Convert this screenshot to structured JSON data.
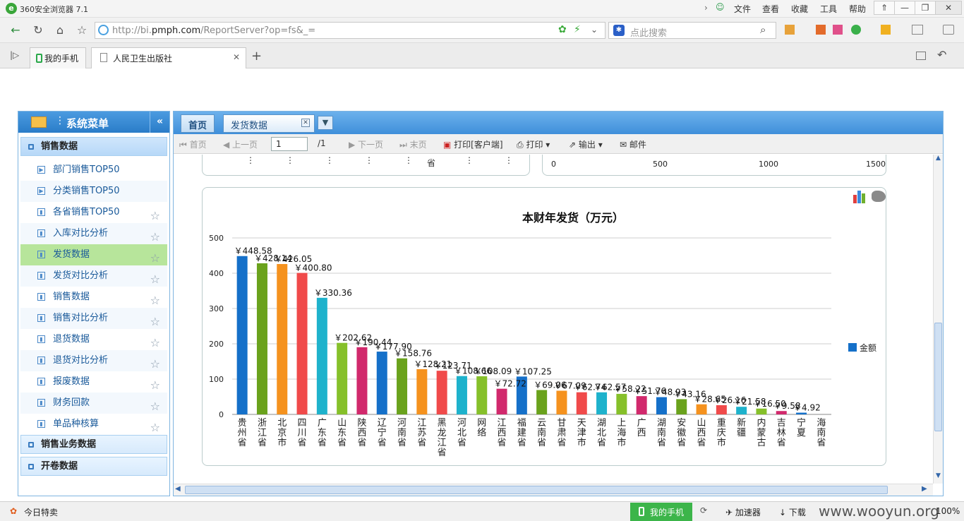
{
  "browser": {
    "title": "360安全浏览器 7.1",
    "logo": "e",
    "menu": [
      "文件",
      "查看",
      "收藏",
      "工具",
      "帮助"
    ],
    "url_prefix": "http://bi.",
    "url_domain": "pmph.com",
    "url_path": "/ReportServer?op=fs&_=",
    "search_placeholder": "点此搜索"
  },
  "tabs": [
    {
      "label": "我的手机"
    },
    {
      "label": "人民卫生出版社"
    }
  ],
  "sidebar": {
    "title": "系统菜单",
    "collapse_glyph": "«",
    "groups": [
      {
        "label": "销售数据"
      },
      {
        "label": "销售业务数据"
      },
      {
        "label": "开卷数据"
      }
    ],
    "items": [
      {
        "label": "部门销售TOP50"
      },
      {
        "label": "分类销售TOP50"
      },
      {
        "label": "各省销售TOP50"
      },
      {
        "label": "入库对比分析"
      },
      {
        "label": "发货数据"
      },
      {
        "label": "发货对比分析"
      },
      {
        "label": "销售数据"
      },
      {
        "label": "销售对比分析"
      },
      {
        "label": "退货数据"
      },
      {
        "label": "退货对比分析"
      },
      {
        "label": "报废数据"
      },
      {
        "label": "财务回款"
      },
      {
        "label": "单品种核算"
      }
    ]
  },
  "main": {
    "tabs": [
      {
        "label": "首页"
      },
      {
        "label": "发货数据"
      }
    ],
    "toolbar": {
      "first": "首页",
      "prev": "上一页",
      "page": "1",
      "total": "/1",
      "next": "下一页",
      "last": "末页",
      "print_client": "打印[客户端]",
      "print": "打印",
      "export": "输出",
      "mail": "邮件"
    },
    "top_chart_ticks": [
      "0",
      "500",
      "1000",
      "1500"
    ],
    "top_chart_partial_label": "省"
  },
  "chart_data": {
    "type": "bar",
    "title": "本财年发货（万元）",
    "legend": "金额",
    "legend_position": "right",
    "ylim": [
      0,
      500
    ],
    "yticks": [
      "0",
      "100",
      "200",
      "300",
      "400",
      "500"
    ],
    "grid": true,
    "value_prefix": "￥",
    "categories": [
      "贵州省",
      "浙江省",
      "北京市",
      "四川省",
      "广东省",
      "山东省",
      "陕西省",
      "辽宁省",
      "河南省",
      "江苏省",
      "黑龙江省",
      "河北省",
      "网络",
      "江西省",
      "福建省",
      "云南省",
      "甘肃省",
      "天津市",
      "湖北省",
      "上海市",
      "广西",
      "湖南省",
      "安徽省",
      "山西省",
      "重庆市",
      "新疆",
      "内蒙古",
      "吉林省",
      "宁夏",
      "海南省"
    ],
    "values": [
      448.58,
      428.14,
      426.05,
      400.8,
      330.36,
      202.62,
      190.44,
      177.9,
      158.76,
      128.21,
      123.71,
      108.66,
      108.09,
      72.72,
      107.25,
      69.06,
      67.09,
      62.74,
      62.57,
      58.22,
      51.76,
      48.93,
      43.16,
      28.65,
      26.16,
      21.58,
      16.5,
      9.58,
      4.92
    ],
    "colors": [
      "#1570c9",
      "#6aa21c",
      "#f5921e",
      "#f04a4a",
      "#1eb2cc",
      "#86c02a",
      "#d1296c"
    ]
  },
  "status": {
    "left": "今日特卖",
    "phone": "我的手机",
    "accelerate": "加速器",
    "download": "下载",
    "zoom": "100%",
    "watermark": "www.wooyun.org"
  }
}
